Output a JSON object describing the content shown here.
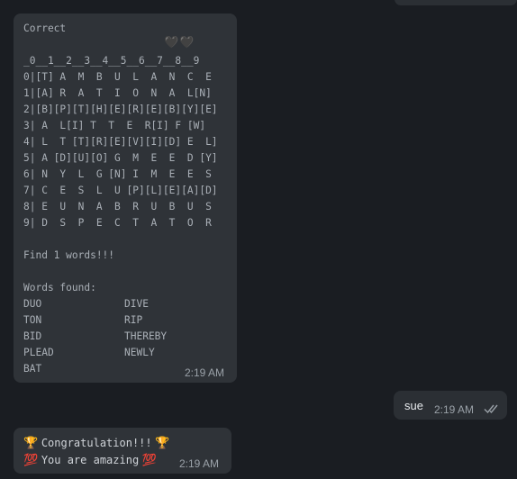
{
  "messages": {
    "grid_message": {
      "status": "Correct",
      "hearts": "🖤🖤",
      "column_header": "_0__1__2__3__4__5__6__7__8__9",
      "rows": [
        "0|[T] A  M  B  U  L  A  N  C  E",
        "1|[A] R  A  T  I  O  N  A  L[N]",
        "2|[B][P][T][H][E][R][E][B][Y][E]",
        "3| A  L[I] T  T  E  R[I] F [W]",
        "4| L  T [T][R][E][V][I][D] E  L]",
        "5| A [D][U][O] G  M  E  E  D [Y]",
        "6| N  Y  L  G [N] I  M  E  E  S",
        "7| C  E  S  L  U [P][L][E][A][D]",
        "8| E  U  N  A  B  R  U  B  U  S",
        "9| D  S  P  E  C  T  A  T  O  R"
      ],
      "find_text": "Find 1 words!!!",
      "words_found_label": "Words found:",
      "words_left": [
        "DUO",
        "TON",
        "BID",
        "PLEAD",
        "BAT"
      ],
      "words_right": [
        "DIVE",
        "RIP",
        "THEREBY",
        "NEWLY"
      ],
      "time": "2:19 AM"
    },
    "sent_message": {
      "text": "sue",
      "time": "2:19 AM",
      "status_icon": "double-check-icon"
    },
    "congrats_message": {
      "line1_prefix": "🏆",
      "line1_text": "Congratulation!!!",
      "line1_suffix": "🏆",
      "line2_prefix": "💯",
      "line2_text": "You are amazing",
      "line2_suffix": "💯",
      "time": "2:19 AM"
    }
  },
  "colors": {
    "background": "#1a1d22",
    "incoming_bubble": "#2f3338",
    "outgoing_bubble": "#2b2f34",
    "text_muted": "#aab0b7",
    "check_color": "#9aa1a8"
  }
}
